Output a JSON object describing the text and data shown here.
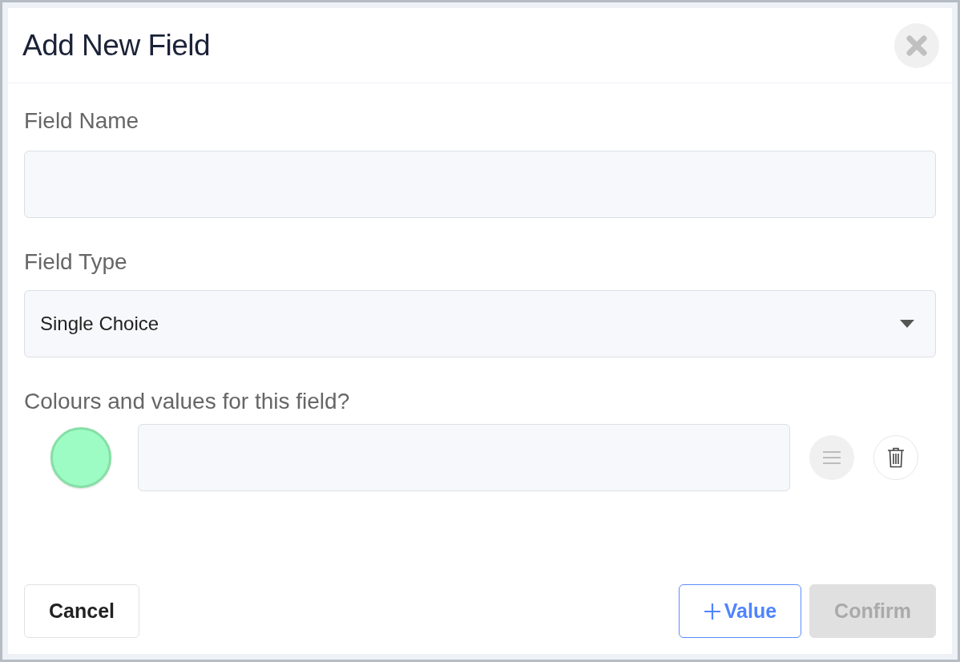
{
  "dialog": {
    "title": "Add New Field"
  },
  "field_name": {
    "label": "Field Name"
  },
  "field_type": {
    "label": "Field Type",
    "value": "Single Choice"
  },
  "values_section": {
    "label": "Colours and values for this field?",
    "values": [
      {
        "color": "#9dfcc4"
      }
    ]
  },
  "buttons": [
    {
      "kind": "cancel",
      "label": "Cancel",
      "disabled": false
    },
    {
      "kind": "add",
      "label": "Value",
      "disabled": false
    },
    {
      "kind": "confirm",
      "label": "Confirm",
      "disabled": true
    }
  ]
}
